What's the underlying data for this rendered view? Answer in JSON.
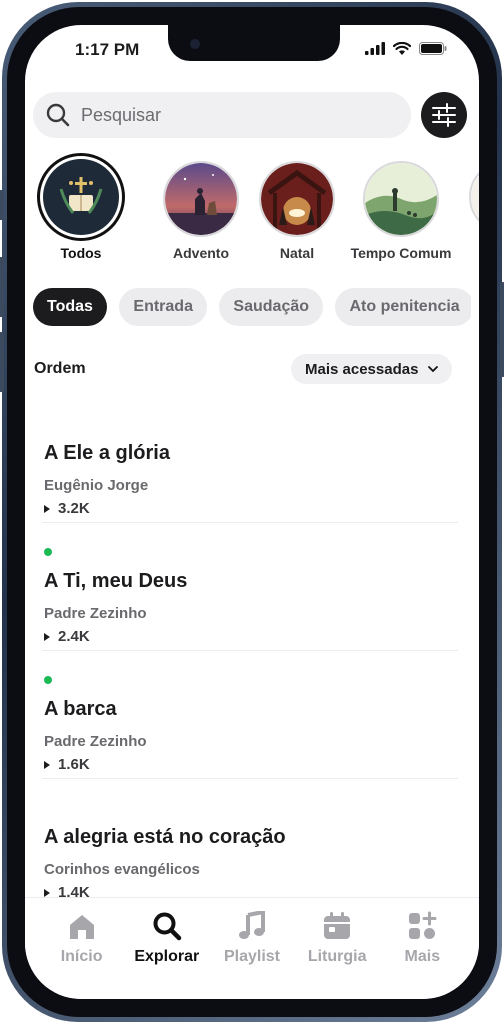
{
  "status_bar": {
    "time": "1:17 PM"
  },
  "search": {
    "placeholder": "Pesquisar"
  },
  "categories": [
    {
      "label": "Todos",
      "active": true
    },
    {
      "label": "Advento",
      "active": false
    },
    {
      "label": "Natal",
      "active": false
    },
    {
      "label": "Tempo Comum",
      "active": false
    }
  ],
  "chips": [
    {
      "label": "Todas",
      "active": true
    },
    {
      "label": "Entrada",
      "active": false
    },
    {
      "label": "Saudação",
      "active": false
    },
    {
      "label": "Ato penitencia",
      "active": false
    }
  ],
  "order": {
    "label": "Ordem",
    "selected": "Mais acessadas"
  },
  "songs": [
    {
      "title": "A Ele a glória",
      "artist": "Eugênio Jorge",
      "plays": "3.2K",
      "new": false
    },
    {
      "title": "A Ti, meu Deus",
      "artist": "Padre Zezinho",
      "plays": "2.4K",
      "new": true
    },
    {
      "title": "A barca",
      "artist": "Padre Zezinho",
      "plays": "1.6K",
      "new": true
    },
    {
      "title": "A alegria está no coração",
      "artist": "Corinhos evangélicos",
      "plays": "1.4K",
      "new": false
    }
  ],
  "tabs": [
    {
      "label": "Início",
      "icon": "home-icon",
      "active": false
    },
    {
      "label": "Explorar",
      "icon": "search-icon",
      "active": true
    },
    {
      "label": "Playlist",
      "icon": "music-note-icon",
      "active": false
    },
    {
      "label": "Liturgia",
      "icon": "calendar-icon",
      "active": false
    },
    {
      "label": "Mais",
      "icon": "more-apps-icon",
      "active": false
    }
  ],
  "colors": {
    "accent": "#1c1c1e",
    "new_dot": "#1db954",
    "inactive": "#a7a7ab"
  }
}
